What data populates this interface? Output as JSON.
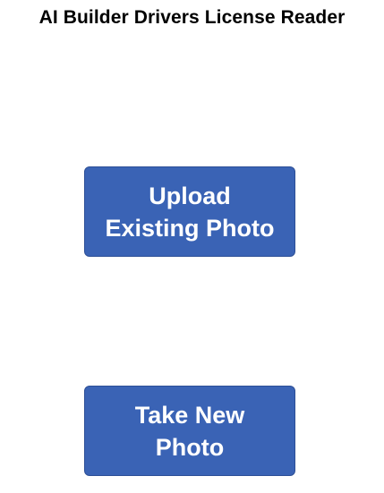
{
  "app": {
    "title": "AI Builder Drivers License Reader"
  },
  "actions": {
    "upload_label": "Upload Existing Photo",
    "take_label": "Take New Photo"
  },
  "colors": {
    "button_fill": "#3a63b5",
    "button_border": "#2d4f96",
    "button_text": "#ffffff",
    "title_text": "#000000",
    "background": "#ffffff"
  }
}
